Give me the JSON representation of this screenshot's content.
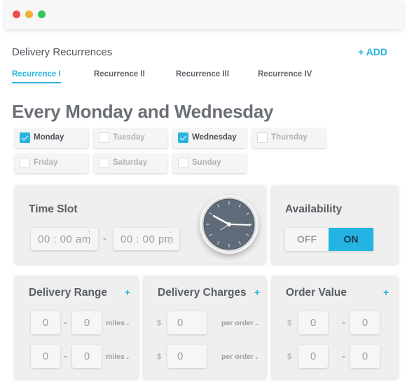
{
  "window": {
    "buttons": [
      "close",
      "minimize",
      "maximize"
    ]
  },
  "header": {
    "title": "Delivery Recurrences",
    "add_label": "+ ADD"
  },
  "tabs": [
    {
      "label": "Recurrence I",
      "active": true
    },
    {
      "label": "Recurrence II",
      "active": false
    },
    {
      "label": "Recurrence III",
      "active": false
    },
    {
      "label": "Recurrence IV",
      "active": false
    }
  ],
  "schedule_heading": "Every Monday and Wednesday",
  "days": [
    {
      "label": "Monday",
      "checked": true
    },
    {
      "label": "Tuesday",
      "checked": false
    },
    {
      "label": "Wednesday",
      "checked": true
    },
    {
      "label": "Thursday",
      "checked": false
    },
    {
      "label": "Friday",
      "checked": false
    },
    {
      "label": "Saturday",
      "checked": false
    },
    {
      "label": "Sunday",
      "checked": false
    }
  ],
  "time_slot": {
    "title": "Time Slot",
    "start": "00 : 00",
    "start_period": "am",
    "separator": "-",
    "end": "00 : 00",
    "end_period": "pm",
    "clock_icon": "clock-icon"
  },
  "availability": {
    "title": "Availability",
    "off_label": "OFF",
    "on_label": "ON",
    "value": "ON"
  },
  "delivery_range": {
    "title": "Delivery Range",
    "plus": "+",
    "rows": [
      {
        "from": "0",
        "sep": "-",
        "to": "0",
        "unit": "miles"
      },
      {
        "from": "0",
        "sep": "-",
        "to": "0",
        "unit": "miles"
      }
    ]
  },
  "delivery_charges": {
    "title": "Delivery Charges",
    "plus": "+",
    "rows": [
      {
        "currency": "$",
        "value": "0",
        "unit": "per order"
      },
      {
        "currency": "$",
        "value": "0",
        "unit": "per order"
      }
    ]
  },
  "order_value": {
    "title": "Order Value",
    "plus": "+",
    "rows": [
      {
        "currency": "$",
        "from": "0",
        "sep": "-",
        "to": "0"
      },
      {
        "currency": "$",
        "from": "0",
        "sep": "-",
        "to": "0"
      }
    ]
  },
  "colors": {
    "accent": "#2ab3e0",
    "toggle_on": "#23b4e3",
    "panel_bg": "#efefef"
  }
}
